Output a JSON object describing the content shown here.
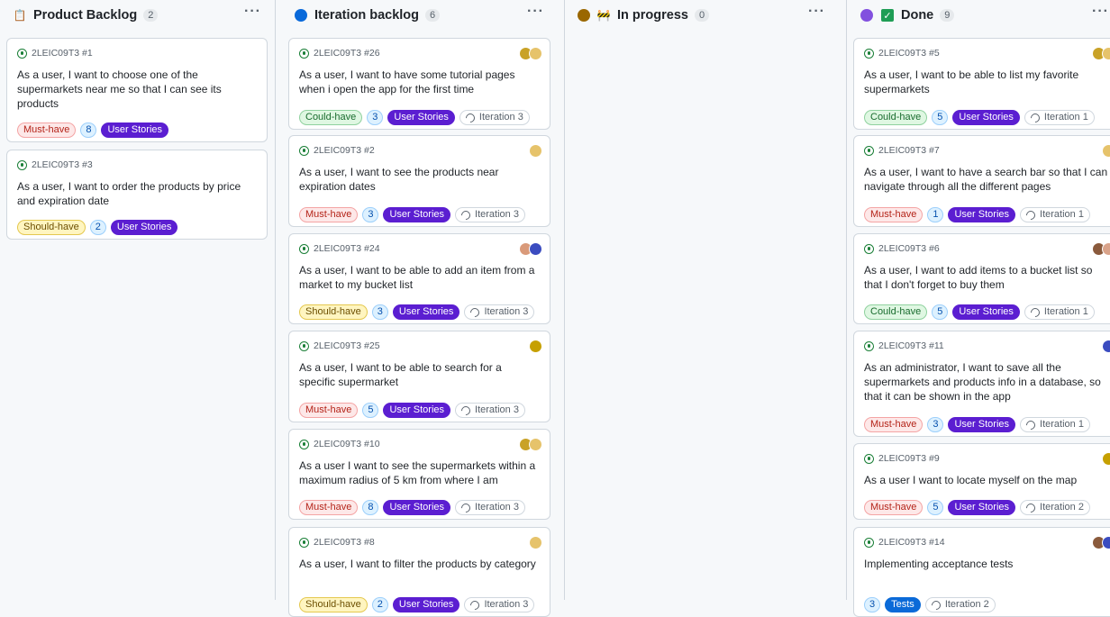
{
  "columns": [
    {
      "title": "Product Backlog",
      "count": "2",
      "menu_icon": "ellipsis-icon",
      "lead_icon": "clipboard-icon",
      "cards": [
        {
          "ref": "2LEIC09T3 #1",
          "text": "As a user, I want to choose one of the supermarkets near me so that I can see its products",
          "priority": "Must-have",
          "points": "8",
          "type": "User Stories",
          "iteration": "",
          "avatars": []
        },
        {
          "ref": "2LEIC09T3 #3",
          "text": "As a user, I want to order the products by price and expiration date",
          "priority": "Should-have",
          "points": "2",
          "type": "User Stories",
          "iteration": "",
          "avatars": []
        }
      ]
    },
    {
      "title": "Iteration backlog",
      "count": "6",
      "menu_icon": "ellipsis-icon",
      "status_color": "#0969da",
      "cards": [
        {
          "ref": "2LEIC09T3 #26",
          "text": "As a user, I want to have some tutorial pages when i open the app for the first time",
          "priority": "Could-have",
          "points": "3",
          "type": "User Stories",
          "iteration": "Iteration 3",
          "avatars": [
            "#c9a227",
            "#e6c36b"
          ]
        },
        {
          "ref": "2LEIC09T3 #2",
          "text": "As a user, I want to see the products near expiration dates",
          "priority": "Must-have",
          "points": "3",
          "type": "User Stories",
          "iteration": "Iteration 3",
          "avatars": [
            "#e6c36b"
          ]
        },
        {
          "ref": "2LEIC09T3 #24",
          "text": "As a user, I want to be able to add an item from a market to my bucket list",
          "priority": "Should-have",
          "points": "3",
          "type": "User Stories",
          "iteration": "Iteration 3",
          "avatars": [
            "#d99a7a",
            "#3b4cc0"
          ]
        },
        {
          "ref": "2LEIC09T3 #25",
          "text": "As a user, I want to be able to search for a specific supermarket",
          "priority": "Must-have",
          "points": "5",
          "type": "User Stories",
          "iteration": "Iteration 3",
          "avatars": [
            "#c6a000"
          ]
        },
        {
          "ref": "2LEIC09T3 #10",
          "text": "As a user I want to see the supermarkets within a maximum radius of 5 km from where I am",
          "priority": "Must-have",
          "points": "8",
          "type": "User Stories",
          "iteration": "Iteration 3",
          "avatars": [
            "#c9a227",
            "#e6c36b"
          ]
        },
        {
          "ref": "2LEIC09T3 #8",
          "text": "As a user, I want to filter the products by category",
          "priority": "Should-have",
          "points": "2",
          "type": "User Stories",
          "iteration": "Iteration 3",
          "avatars": [
            "#e6c36b"
          ]
        }
      ]
    },
    {
      "title": "In progress",
      "count": "0",
      "menu_icon": "ellipsis-icon",
      "status_color": "#9a6700",
      "lead_icon": "construction-icon",
      "cards": []
    },
    {
      "title": "Done",
      "count": "9",
      "menu_icon": "ellipsis-icon",
      "status_color": "#8250df",
      "lead_icon": "check-box-icon",
      "cards": [
        {
          "ref": "2LEIC09T3 #5",
          "text": "As a user, I want to be able to list my favorite supermarkets",
          "priority": "Could-have",
          "points": "5",
          "type": "User Stories",
          "iteration": "Iteration 1",
          "avatars": [
            "#c9a227",
            "#e6c36b"
          ]
        },
        {
          "ref": "2LEIC09T3 #7",
          "text": "As a user, I want to have a search bar so that I can navigate through all the different pages",
          "priority": "Must-have",
          "points": "1",
          "type": "User Stories",
          "iteration": "Iteration 1",
          "avatars": [
            "#e6c36b"
          ]
        },
        {
          "ref": "2LEIC09T3 #6",
          "text": "As a user, I want to add items to a bucket list so that I don't forget to buy them",
          "priority": "Could-have",
          "points": "5",
          "type": "User Stories",
          "iteration": "Iteration 1",
          "avatars": [
            "#8a5a3c",
            "#d9a38a"
          ]
        },
        {
          "ref": "2LEIC09T3 #11",
          "text": "As an administrator, I want to save all the supermarkets and products info in a database, so that it can be shown in the app",
          "priority": "Must-have",
          "points": "3",
          "type": "User Stories",
          "iteration": "Iteration 1",
          "avatars": [
            "#3b4cc0"
          ]
        },
        {
          "ref": "2LEIC09T3 #9",
          "text": "As a user I want to locate myself on the map",
          "priority": "Must-have",
          "points": "5",
          "type": "User Stories",
          "iteration": "Iteration 2",
          "avatars": [
            "#c6a000"
          ]
        },
        {
          "ref": "2LEIC09T3 #14",
          "text": "Implementing acceptance tests",
          "priority": "",
          "points": "3",
          "type": "Tests",
          "iteration": "Iteration 2",
          "avatars": [
            "#8a5a3c",
            "#3b4cc0"
          ]
        }
      ]
    }
  ]
}
